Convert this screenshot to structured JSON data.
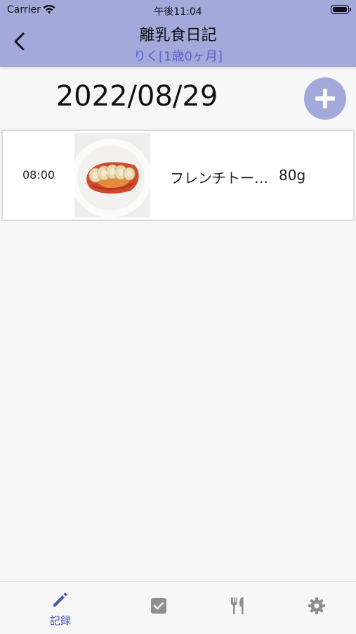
{
  "status_bar": {
    "carrier": "Carrier",
    "time": "午後11:04"
  },
  "nav": {
    "title": "離乳食日記",
    "subtitle": "りく[1歳0ヶ月]"
  },
  "date_header": {
    "date": "2022/08/29"
  },
  "records": [
    {
      "time": "08:00",
      "food": "フレンチトー…",
      "amount": "80g"
    }
  ],
  "tabs": [
    {
      "label": "記録",
      "icon": "pencil-icon",
      "active": true
    },
    {
      "label": "",
      "icon": "checkbox-icon",
      "active": false
    },
    {
      "label": "",
      "icon": "fork-knife-icon",
      "active": false
    },
    {
      "label": "",
      "icon": "gear-icon",
      "active": false
    }
  ],
  "colors": {
    "accent": "#a3a9db",
    "active_tab": "#4a56b8",
    "subtitle": "#5a66c8"
  }
}
